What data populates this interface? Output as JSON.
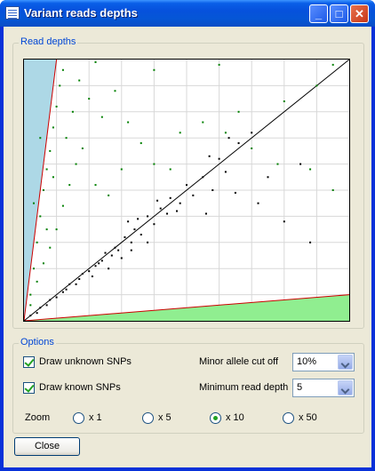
{
  "window": {
    "title": "Variant reads depths",
    "buttons": {
      "minimize": "_",
      "maximize": "□",
      "close": "✕"
    }
  },
  "read_depths": {
    "group_label": "Read depths"
  },
  "options": {
    "group_label": "Options",
    "draw_unknown_label": "Draw unknown SNPs",
    "draw_unknown_checked": true,
    "draw_known_label": "Draw known SNPs",
    "draw_known_checked": true,
    "minor_allele_label": "Minor allele cut off",
    "minor_allele_value": "10%",
    "min_read_depth_label": "Minimum read depth",
    "min_read_depth_value": "5",
    "zoom_label": "Zoom",
    "zoom_options": [
      "x 1",
      "x 5",
      "x 10",
      "x 50"
    ],
    "zoom_selected": "x 10"
  },
  "close_button": "Close",
  "colors": {
    "accent": "#0046d5",
    "unknown_snp": "#008000",
    "known_snp": "#000000",
    "upper_region": "#add8e6",
    "lower_region": "#90ee90",
    "cutoff_line": "#cc0000"
  },
  "chart_data": {
    "type": "scatter",
    "grid": true,
    "xlim": [
      0,
      100
    ],
    "ylim": [
      0,
      100
    ],
    "cutoff_fraction": 0.1,
    "series": [
      {
        "color": "#000000",
        "points": [
          [
            2,
            2
          ],
          [
            4,
            3
          ],
          [
            5,
            5
          ],
          [
            7,
            6
          ],
          [
            8,
            8
          ],
          [
            10,
            9
          ],
          [
            12,
            11
          ],
          [
            13,
            12
          ],
          [
            14,
            14
          ],
          [
            16,
            14
          ],
          [
            17,
            16
          ],
          [
            18,
            18
          ],
          [
            20,
            19
          ],
          [
            22,
            21
          ],
          [
            23,
            22
          ],
          [
            24,
            23
          ],
          [
            25,
            26
          ],
          [
            27,
            25
          ],
          [
            28,
            28
          ],
          [
            29,
            27
          ],
          [
            31,
            32
          ],
          [
            33,
            30
          ],
          [
            34,
            35
          ],
          [
            36,
            33
          ],
          [
            38,
            40
          ],
          [
            40,
            37
          ],
          [
            42,
            43
          ],
          [
            44,
            41
          ],
          [
            45,
            47
          ],
          [
            48,
            45
          ],
          [
            50,
            52
          ],
          [
            52,
            48
          ],
          [
            55,
            55
          ],
          [
            58,
            50
          ],
          [
            60,
            62
          ],
          [
            62,
            57
          ],
          [
            66,
            68
          ],
          [
            70,
            72
          ],
          [
            38,
            30
          ],
          [
            30,
            24
          ],
          [
            26,
            20
          ],
          [
            21,
            17
          ],
          [
            47,
            42
          ],
          [
            35,
            39
          ],
          [
            32,
            38
          ],
          [
            41,
            46
          ],
          [
            57,
            63
          ],
          [
            63,
            70
          ],
          [
            72,
            45
          ],
          [
            80,
            38
          ],
          [
            88,
            30
          ],
          [
            65,
            49
          ],
          [
            75,
            55
          ],
          [
            85,
            60
          ],
          [
            33,
            27
          ],
          [
            56,
            41
          ]
        ]
      },
      {
        "color": "#008000",
        "points": [
          [
            2,
            10
          ],
          [
            3,
            20
          ],
          [
            4,
            30
          ],
          [
            5,
            40
          ],
          [
            6,
            50
          ],
          [
            7,
            58
          ],
          [
            8,
            65
          ],
          [
            9,
            74
          ],
          [
            10,
            82
          ],
          [
            11,
            90
          ],
          [
            12,
            96
          ],
          [
            3,
            45
          ],
          [
            5,
            70
          ],
          [
            7,
            35
          ],
          [
            9,
            55
          ],
          [
            13,
            70
          ],
          [
            15,
            80
          ],
          [
            17,
            92
          ],
          [
            20,
            85
          ],
          [
            24,
            78
          ],
          [
            28,
            88
          ],
          [
            32,
            76
          ],
          [
            36,
            68
          ],
          [
            40,
            60
          ],
          [
            45,
            58
          ],
          [
            55,
            76
          ],
          [
            62,
            72
          ],
          [
            70,
            66
          ],
          [
            78,
            60
          ],
          [
            88,
            58
          ],
          [
            95,
            50
          ],
          [
            4,
            15
          ],
          [
            6,
            22
          ],
          [
            8,
            28
          ],
          [
            10,
            35
          ],
          [
            12,
            44
          ],
          [
            14,
            52
          ],
          [
            16,
            60
          ],
          [
            18,
            66
          ],
          [
            2,
            6
          ],
          [
            22,
            52
          ],
          [
            26,
            48
          ],
          [
            30,
            58
          ],
          [
            48,
            72
          ],
          [
            66,
            80
          ],
          [
            80,
            84
          ],
          [
            90,
            90
          ],
          [
            95,
            98
          ],
          [
            60,
            98
          ],
          [
            40,
            96
          ],
          [
            22,
            99
          ]
        ]
      }
    ]
  }
}
